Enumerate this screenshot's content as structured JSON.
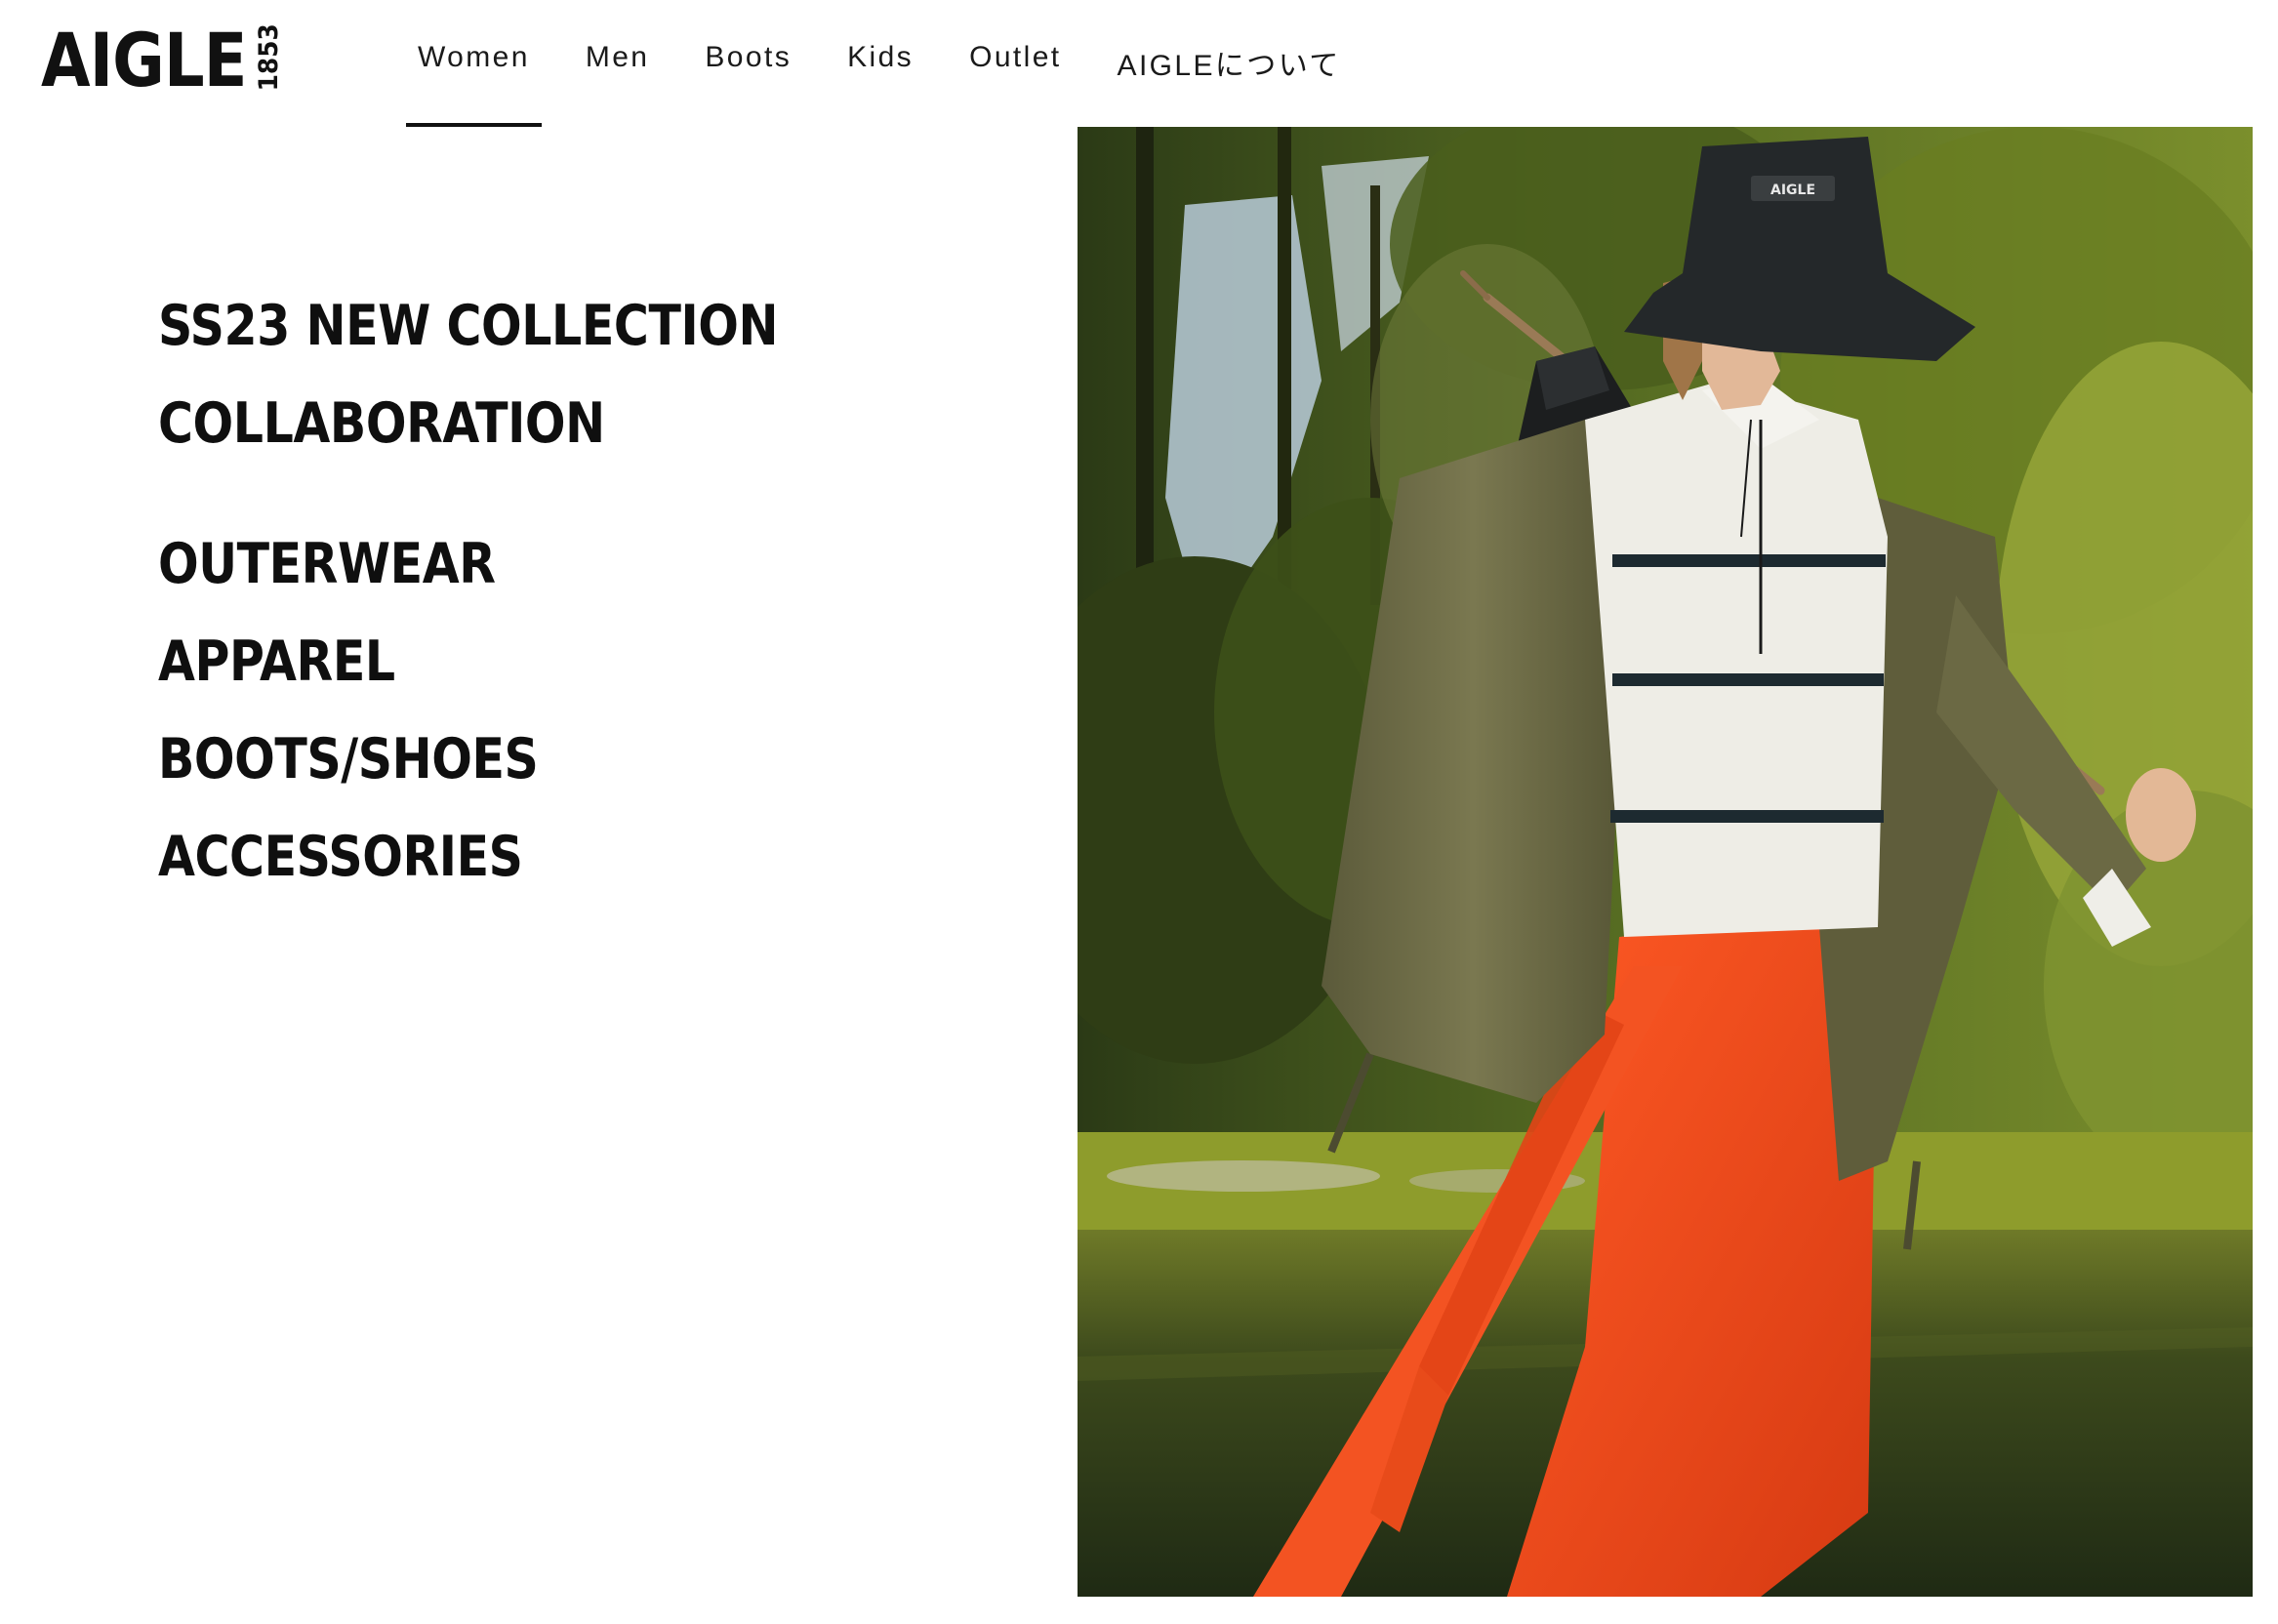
{
  "brand": {
    "name": "AIGLE",
    "year": "1853"
  },
  "nav": {
    "items": [
      {
        "label": "Women",
        "active": true
      },
      {
        "label": "Men",
        "active": false
      },
      {
        "label": "Boots",
        "active": false
      },
      {
        "label": "Kids",
        "active": false
      },
      {
        "label": "Outlet",
        "active": false
      },
      {
        "label": "AIGLEについて",
        "active": false
      }
    ]
  },
  "menu": {
    "featured": [
      {
        "label": "SS23 NEW COLLECTION"
      },
      {
        "label": "COLLABORATION"
      }
    ],
    "categories": [
      {
        "label": "OUTERWEAR"
      },
      {
        "label": "APPAREL"
      },
      {
        "label": "BOOTS/SHOES"
      },
      {
        "label": "ACCESSORIES"
      }
    ]
  },
  "hero": {
    "hat_logo_text": "AIGLE",
    "colors": {
      "foliage_dark": "#2f3b18",
      "foliage_light": "#8a9a34",
      "sky": "#c9d8e6",
      "jacket": "#6d6a45",
      "sweater": "#efeeea",
      "stripe": "#1f2d33",
      "skirt": "#f04a1c",
      "hat": "#24282a",
      "water": "#2a3318"
    }
  }
}
